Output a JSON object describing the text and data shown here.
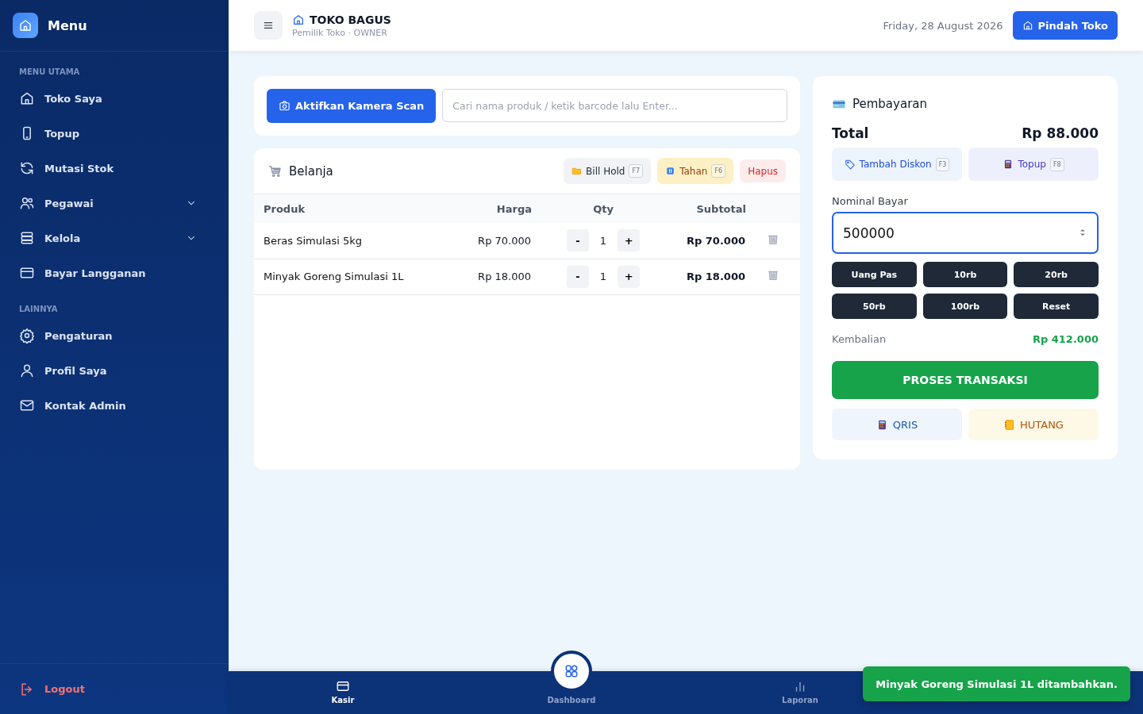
{
  "sidebar": {
    "title": "Menu",
    "sections": [
      {
        "heading": "MENU UTAMA",
        "items": [
          {
            "label": "Toko Saya",
            "kind": "link"
          },
          {
            "label": "Topup",
            "kind": "link"
          },
          {
            "label": "Mutasi Stok",
            "kind": "link"
          },
          {
            "label": "Pegawai",
            "kind": "dropdown"
          },
          {
            "label": "Kelola",
            "kind": "dropdown"
          },
          {
            "label": "Bayar Langganan",
            "kind": "link"
          }
        ]
      },
      {
        "heading": "LAINNYA",
        "items": [
          {
            "label": "Pengaturan",
            "kind": "link"
          },
          {
            "label": "Profil Saya",
            "kind": "link"
          },
          {
            "label": "Kontak Admin",
            "kind": "link"
          }
        ]
      }
    ],
    "logout": "Logout"
  },
  "header": {
    "store_name": "TOKO BAGUS",
    "subtitle": "Pemilik Toko · OWNER",
    "date": "Friday, 28 August 2026",
    "switch_button": "Pindah Toko"
  },
  "scan": {
    "camera_button": "Aktifkan Kamera Scan",
    "search": {
      "placeholder": "Cari nama produk / ketik barcode lalu Enter..."
    }
  },
  "cart": {
    "title": "Belanja",
    "actions": [
      {
        "label": "Bill Hold",
        "shortcut": "F7",
        "kind": "neutral"
      },
      {
        "label": "Tahan",
        "shortcut": "F6",
        "kind": "warning"
      },
      {
        "label": "Hapus",
        "kind": "danger"
      }
    ],
    "columns": [
      "Produk",
      "Harga",
      "Qty",
      "Subtotal"
    ],
    "rows": [
      {
        "product": "Beras Simulasi 5kg",
        "price": "Rp 70.000",
        "minus": "-",
        "qty": "1",
        "plus": "+",
        "subtotal": "Rp 70.000"
      },
      {
        "product": "Minyak Goreng Simulasi 1L",
        "price": "Rp 18.000",
        "minus": "-",
        "qty": "1",
        "plus": "+",
        "subtotal": "Rp 18.000"
      }
    ]
  },
  "payment": {
    "title": "Pembayaran",
    "total_label": "Total",
    "total": "Rp 88.000",
    "actions": [
      {
        "label": "Tambah Diskon",
        "shortcut": "F3",
        "kind": "discount"
      },
      {
        "label": "Topup",
        "shortcut": "F8",
        "kind": "topup"
      }
    ],
    "amount_label": "Nominal Bayar",
    "amount": "500000",
    "quick_amounts": [
      "Uang Pas",
      "10rb",
      "20rb",
      "50rb",
      "100rb",
      "Reset"
    ],
    "change_label": "Kembalian",
    "change": "Rp 412.000",
    "process_button": "PROSES TRANSAKSI",
    "methods": [
      {
        "label": "QRIS",
        "kind": "qris"
      },
      {
        "label": "HUTANG",
        "kind": "debt"
      }
    ]
  },
  "bottom_nav": [
    {
      "label": "Kasir",
      "kind": "tab",
      "selected": true
    },
    {
      "label": "Dashboard",
      "kind": "center",
      "selected": false
    },
    {
      "label": "Laporan",
      "kind": "tab",
      "selected": false
    }
  ],
  "toast": "Minyak Goreng Simulasi 1L ditambahkan."
}
